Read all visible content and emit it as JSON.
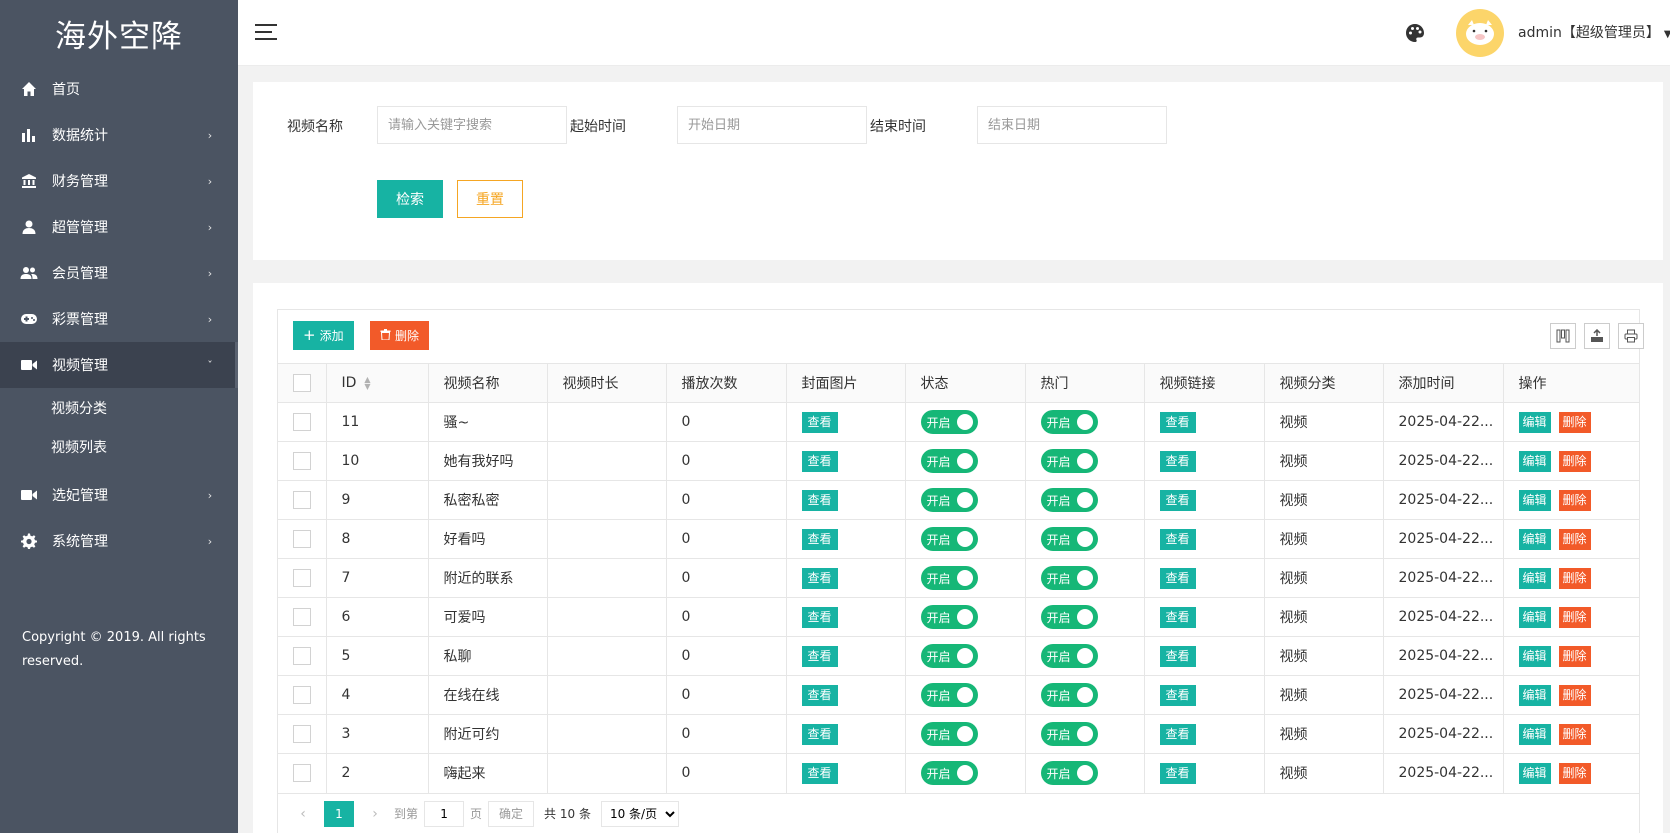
{
  "brand": "海外空降",
  "sidebar": {
    "items": [
      {
        "label": "首页",
        "icon": "home-icon"
      },
      {
        "label": "数据统计",
        "icon": "bar-chart-icon"
      },
      {
        "label": "财务管理",
        "icon": "bank-icon"
      },
      {
        "label": "超管管理",
        "icon": "user-icon"
      },
      {
        "label": "会员管理",
        "icon": "users-icon"
      },
      {
        "label": "彩票管理",
        "icon": "gamepad-icon"
      },
      {
        "label": "视频管理",
        "icon": "video-icon"
      },
      {
        "label": "选妃管理",
        "icon": "video-icon"
      },
      {
        "label": "系统管理",
        "icon": "gear-icon"
      }
    ],
    "video_sub": [
      "视频分类",
      "视频列表"
    ],
    "copyright": "Copyright © 2019. All rights reserved."
  },
  "header": {
    "user": "admin【超级管理员】",
    "avatar_color": "#fcd56a"
  },
  "search": {
    "name_label": "视频名称",
    "name_placeholder": "请输入关键字搜索",
    "start_label": "起始时间",
    "start_placeholder": "开始日期",
    "end_label": "结束时间",
    "end_placeholder": "结束日期",
    "search_btn": "检索",
    "reset_btn": "重置"
  },
  "toolbar": {
    "add_label": "添加",
    "delete_label": "删除"
  },
  "table": {
    "columns": [
      "ID",
      "视频名称",
      "视频时长",
      "播放次数",
      "封面图片",
      "状态",
      "热门",
      "视频链接",
      "视频分类",
      "添加时间",
      "操作"
    ],
    "rows": [
      {
        "id": "11",
        "name": "骚~",
        "duration": "",
        "plays": "0",
        "cover": "查看",
        "status": "开启",
        "hot": "开启",
        "link": "查看",
        "category": "视频",
        "added": "2025-04-22...",
        "edit": "编辑",
        "del": "删除"
      },
      {
        "id": "10",
        "name": "她有我好吗",
        "duration": "",
        "plays": "0",
        "cover": "查看",
        "status": "开启",
        "hot": "开启",
        "link": "查看",
        "category": "视频",
        "added": "2025-04-22...",
        "edit": "编辑",
        "del": "删除"
      },
      {
        "id": "9",
        "name": "私密私密",
        "duration": "",
        "plays": "0",
        "cover": "查看",
        "status": "开启",
        "hot": "开启",
        "link": "查看",
        "category": "视频",
        "added": "2025-04-22...",
        "edit": "编辑",
        "del": "删除"
      },
      {
        "id": "8",
        "name": "好看吗",
        "duration": "",
        "plays": "0",
        "cover": "查看",
        "status": "开启",
        "hot": "开启",
        "link": "查看",
        "category": "视频",
        "added": "2025-04-22...",
        "edit": "编辑",
        "del": "删除"
      },
      {
        "id": "7",
        "name": "附近的联系",
        "duration": "",
        "plays": "0",
        "cover": "查看",
        "status": "开启",
        "hot": "开启",
        "link": "查看",
        "category": "视频",
        "added": "2025-04-22...",
        "edit": "编辑",
        "del": "删除"
      },
      {
        "id": "6",
        "name": "可爱吗",
        "duration": "",
        "plays": "0",
        "cover": "查看",
        "status": "开启",
        "hot": "开启",
        "link": "查看",
        "category": "视频",
        "added": "2025-04-22...",
        "edit": "编辑",
        "del": "删除"
      },
      {
        "id": "5",
        "name": "私聊",
        "duration": "",
        "plays": "0",
        "cover": "查看",
        "status": "开启",
        "hot": "开启",
        "link": "查看",
        "category": "视频",
        "added": "2025-04-22...",
        "edit": "编辑",
        "del": "删除"
      },
      {
        "id": "4",
        "name": "在线在线",
        "duration": "",
        "plays": "0",
        "cover": "查看",
        "status": "开启",
        "hot": "开启",
        "link": "查看",
        "category": "视频",
        "added": "2025-04-22...",
        "edit": "编辑",
        "del": "删除"
      },
      {
        "id": "3",
        "name": "附近可约",
        "duration": "",
        "plays": "0",
        "cover": "查看",
        "status": "开启",
        "hot": "开启",
        "link": "查看",
        "category": "视频",
        "added": "2025-04-22...",
        "edit": "编辑",
        "del": "删除"
      },
      {
        "id": "2",
        "name": "嗨起来",
        "duration": "",
        "plays": "0",
        "cover": "查看",
        "status": "开启",
        "hot": "开启",
        "link": "查看",
        "category": "视频",
        "added": "2025-04-22...",
        "edit": "编辑",
        "del": "删除"
      }
    ]
  },
  "pager": {
    "current": "1",
    "goto_label": "到第",
    "page_value": "1",
    "page_unit": "页",
    "confirm": "确定",
    "total": "共 10 条",
    "page_size": "10 条/页"
  },
  "colors": {
    "sidebar_bg": "#4b5462",
    "primary": "#17b3a3",
    "danger": "#f25a29",
    "switch_on": "#16b777",
    "warning": "#f5a623"
  }
}
